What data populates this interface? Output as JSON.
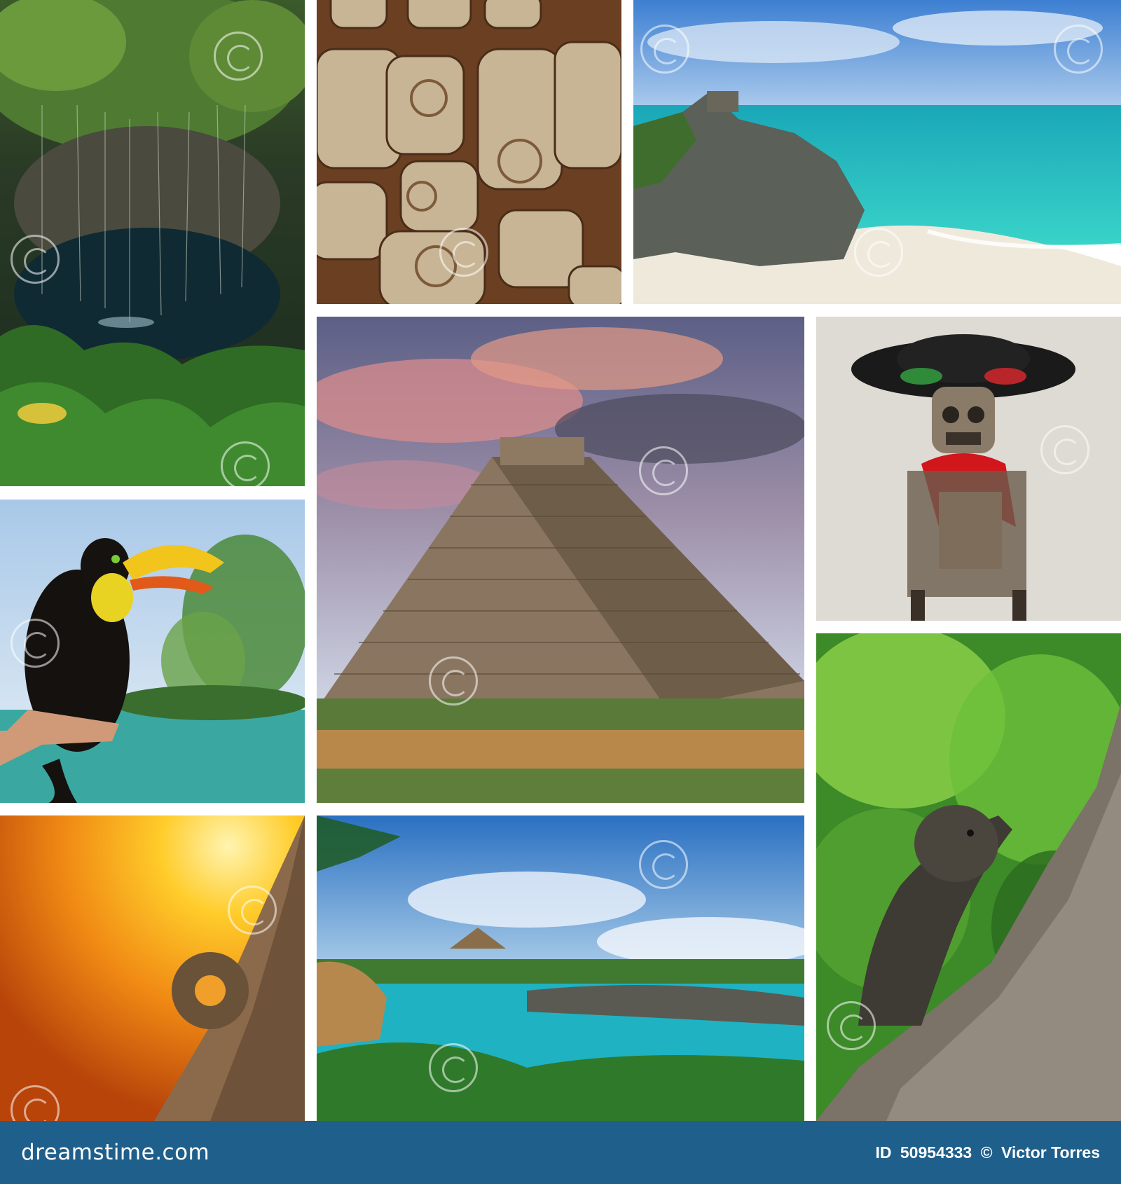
{
  "footer": {
    "brand": "dreamstime.com",
    "id_label": "ID",
    "id_value": "50954333",
    "copyright": "©",
    "author": "Victor Torres"
  },
  "colors": {
    "footer_bar": "#1f5f8b",
    "background": "#ffffff"
  },
  "tiles": [
    {
      "name": "cenote-photo"
    },
    {
      "name": "mayan-glyphs-photo"
    },
    {
      "name": "tulum-beach-photo"
    },
    {
      "name": "pyramid-photo"
    },
    {
      "name": "skeleton-sombrero-photo"
    },
    {
      "name": "toucan-photo"
    },
    {
      "name": "iguana-photo"
    },
    {
      "name": "ballgame-ring-photo"
    },
    {
      "name": "lagoon-photo"
    }
  ]
}
